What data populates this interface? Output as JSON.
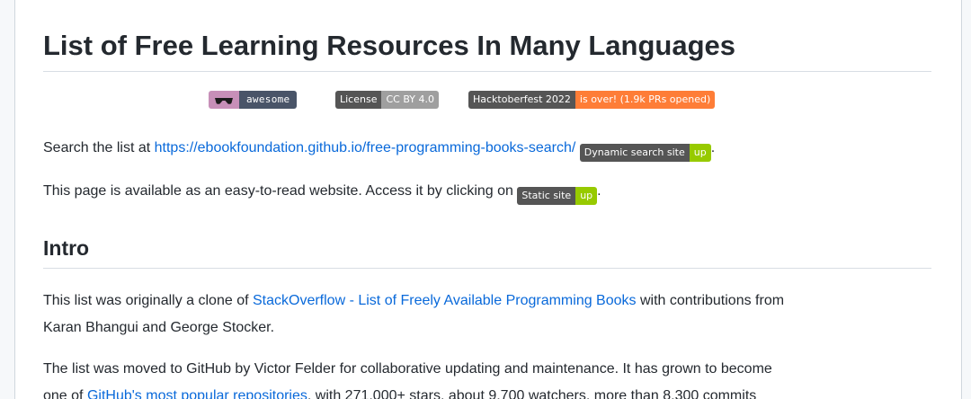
{
  "readme": {
    "title": "List of Free Learning Resources In Many Languages",
    "badges": [
      {
        "left": "",
        "right": "awesome"
      },
      {
        "left": "License",
        "right": "CC BY 4.0"
      },
      {
        "left": "Hacktoberfest 2022",
        "right": "is over! (1.9k PRs opened)"
      }
    ],
    "search_line": {
      "prefix": "Search the list at ",
      "link": "https://ebookfoundation.github.io/free-programming-books-search/",
      "badge_left": "Dynamic search site",
      "badge_right": "up",
      "suffix": "."
    },
    "static_line": {
      "prefix": "This page is available as an easy-to-read website. Access it by clicking on ",
      "badge_left": "Static site",
      "badge_right": "up",
      "suffix": "."
    },
    "intro_heading": "Intro",
    "intro_p1": {
      "prefix": "This list was originally a clone of ",
      "link": "StackOverflow - List of Freely Available Programming Books",
      "suffix_line1": " with contributions from",
      "line2": "Karan Bhangui and George Stocker."
    },
    "intro_p2": {
      "line1": "The list was moved to GitHub by Victor Felder for collaborative updating and maintenance. It has grown to become",
      "line2_prefix": "one of ",
      "line2_link": "GitHub's most popular repositories",
      "line2_suffix": ", with 271,000+ stars, about 9,700 watchers, more than 8,300 commits"
    }
  },
  "colors": {
    "link": "#0969da",
    "badge_green": "#97ca00",
    "badge_orange": "#fe7d37",
    "badge_dark": "#555555",
    "awesome_left": "#c78fb8",
    "awesome_right": "#495468"
  },
  "icons": {
    "awesome_badge_logo": "sunglasses-icon"
  }
}
